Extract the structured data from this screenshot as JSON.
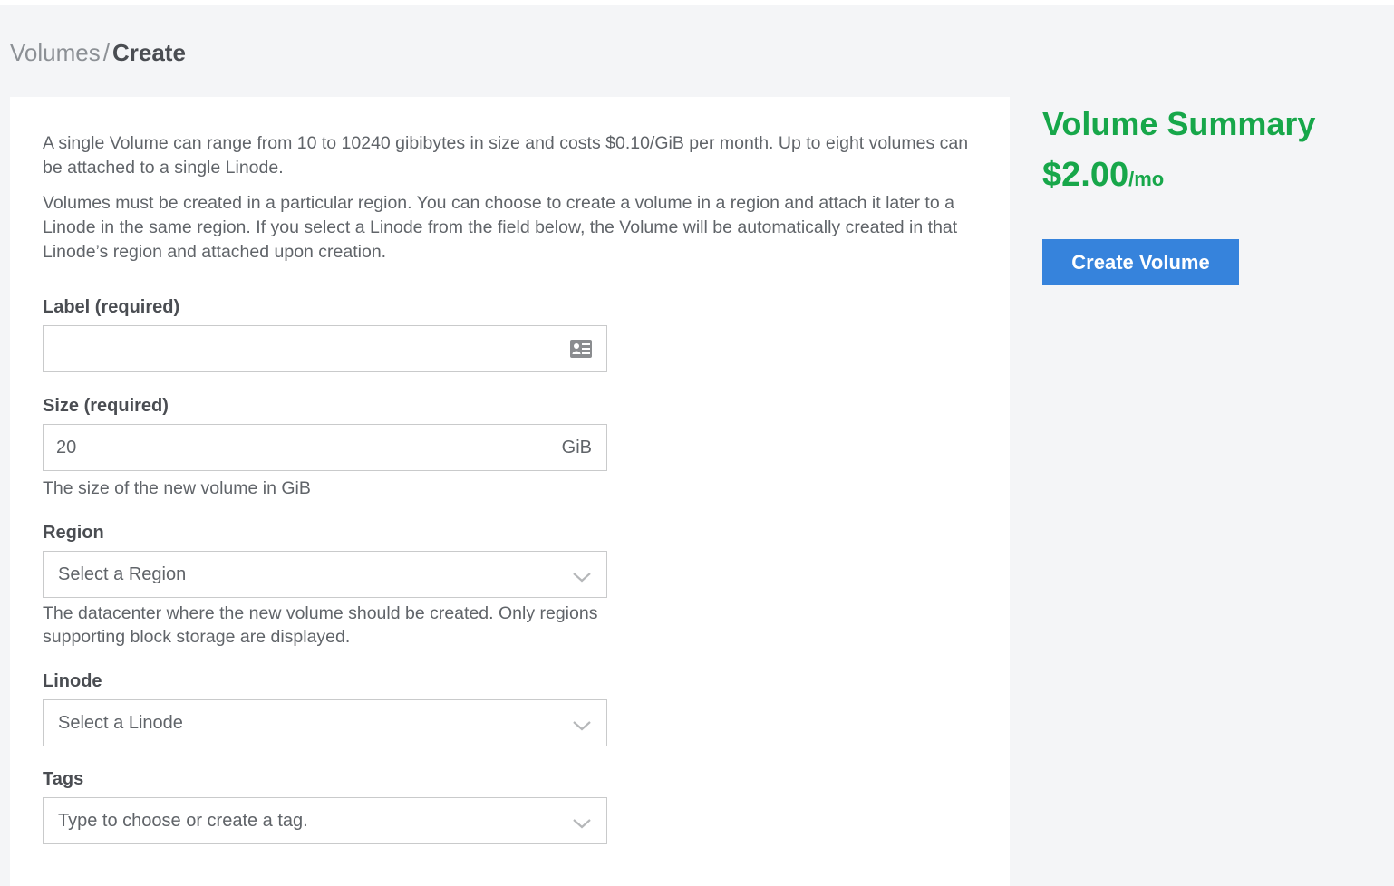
{
  "breadcrumb": {
    "parent": "Volumes",
    "separator": "/",
    "current": "Create"
  },
  "intro": {
    "paragraph1": "A single Volume can range from 10 to 10240 gibibytes in size and costs $0.10/GiB per month. Up to eight volumes can be attached to a single Linode.",
    "paragraph2": "Volumes must be created in a particular region. You can choose to create a volume in a region and attach it later to a Linode in the same region. If you select a Linode from the field below, the Volume will be automatically created in that Linode’s region and attached upon creation."
  },
  "form": {
    "label": {
      "label": "Label (required)",
      "value": "",
      "icon": "id-card-icon"
    },
    "size": {
      "label": "Size (required)",
      "value": "20",
      "suffix": "GiB",
      "helper": "The size of the new volume in GiB"
    },
    "region": {
      "label": "Region",
      "placeholder": "Select a Region",
      "helper": "The datacenter where the new volume should be created. Only regions supporting block storage are displayed.",
      "icon": "chevron-down-icon"
    },
    "linode": {
      "label": "Linode",
      "placeholder": "Select a Linode",
      "icon": "chevron-down-icon"
    },
    "tags": {
      "label": "Tags",
      "placeholder": "Type to choose or create a tag.",
      "icon": "chevron-down-icon"
    }
  },
  "summary": {
    "title": "Volume Summary",
    "price": "$2.00",
    "price_unit": "/mo",
    "create_button": "Create Volume"
  },
  "colors": {
    "accent_green": "#17a74a",
    "primary_blue": "#3683dc",
    "background": "#f4f5f7"
  }
}
